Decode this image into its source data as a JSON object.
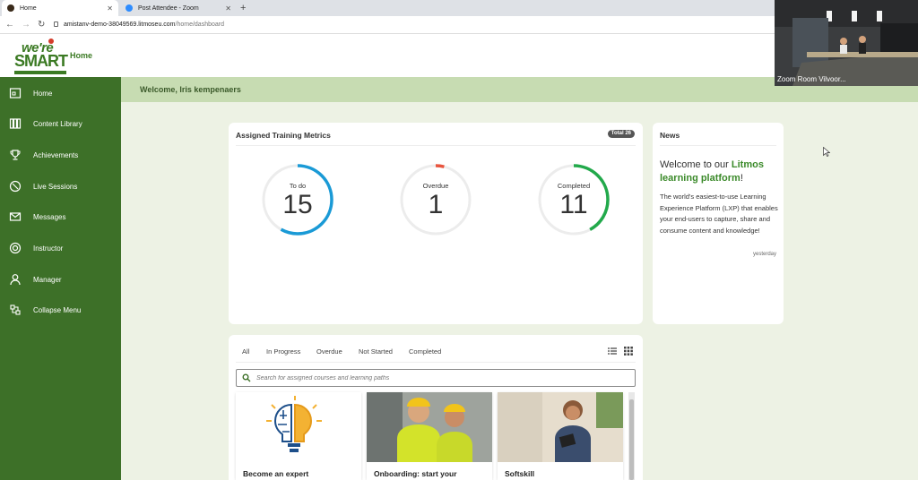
{
  "browser": {
    "tabs": [
      {
        "title": "Home",
        "active": true
      },
      {
        "title": "Post Attendee - Zoom",
        "active": false
      }
    ],
    "url_host": "amistanv-demo-38049569.litmoseu.com",
    "url_path": "/home/dashboard"
  },
  "header": {
    "logo_line1": "we're",
    "logo_line2": "SMART",
    "title": "Home"
  },
  "sidebar": {
    "items": [
      {
        "label": "Home",
        "icon": "home-icon"
      },
      {
        "label": "Content Library",
        "icon": "library-icon"
      },
      {
        "label": "Achievements",
        "icon": "trophy-icon"
      },
      {
        "label": "Live Sessions",
        "icon": "live-sessions-icon"
      },
      {
        "label": "Messages",
        "icon": "envelope-icon"
      },
      {
        "label": "Instructor",
        "icon": "instructor-icon"
      },
      {
        "label": "Manager",
        "icon": "user-icon"
      },
      {
        "label": "Collapse Menu",
        "icon": "collapse-icon"
      }
    ],
    "bg_color": "#3d7028"
  },
  "welcome": "Welcome, Iris kempenaers",
  "metrics": {
    "title": "Assigned Training Metrics",
    "total_badge": "Total 26",
    "items": [
      {
        "label": "To do",
        "value": "15",
        "fraction": 0.58,
        "color": "#1a9ad6"
      },
      {
        "label": "Overdue",
        "value": "1",
        "fraction": 0.04,
        "color": "#e8553e"
      },
      {
        "label": "Completed",
        "value": "11",
        "fraction": 0.42,
        "color": "#22a94b"
      }
    ]
  },
  "news": {
    "title": "News",
    "headline_pre": "Welcome to our ",
    "headline_brand": "Litmos learning platform",
    "headline_post": "!",
    "body": "The world's easiest-to-use Learning Experience Platform (LXP) that enables your end-users to capture, share and consume content and knowledge!",
    "date": "yesterday"
  },
  "courses": {
    "filters": [
      "All",
      "In Progress",
      "Overdue",
      "Not Started",
      "Completed"
    ],
    "search_placeholder": "Search for assigned courses and learning paths",
    "items": [
      {
        "title": "Become an expert"
      },
      {
        "title": "Onboarding: start your"
      },
      {
        "title": "Softskill"
      }
    ]
  },
  "zoom": {
    "label": "Zoom Room Vilvoor..."
  }
}
